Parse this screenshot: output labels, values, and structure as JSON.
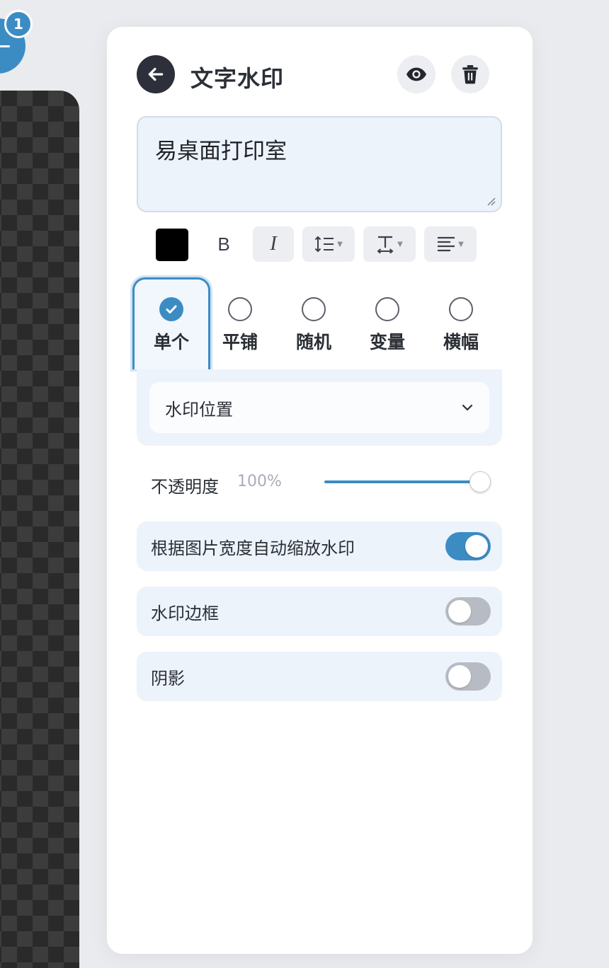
{
  "canvas": {
    "layer_badge": "1"
  },
  "panel": {
    "title": "文字水印",
    "back_icon": "arrow-left-icon",
    "preview_icon": "eye-icon",
    "delete_icon": "trash-icon"
  },
  "text_input": {
    "value": "易桌面打印室"
  },
  "toolbar": {
    "color": "#000000",
    "bold_label": "B",
    "italic_label": "I",
    "line_height_icon": "line-height-icon",
    "letter_spacing_icon": "text-height-icon",
    "align_icon": "align-left-icon"
  },
  "modes": [
    {
      "label": "单个",
      "selected": true
    },
    {
      "label": "平铺",
      "selected": false
    },
    {
      "label": "随机",
      "selected": false
    },
    {
      "label": "变量",
      "selected": false
    },
    {
      "label": "横幅",
      "selected": false
    }
  ],
  "position": {
    "label": "水印位置"
  },
  "opacity": {
    "label": "不透明度",
    "value": "100%",
    "fraction": 1.0
  },
  "toggles": [
    {
      "label": "根据图片宽度自动缩放水印",
      "on": true
    },
    {
      "label": "水印边框",
      "on": false
    },
    {
      "label": "阴影",
      "on": false
    }
  ],
  "colors": {
    "accent": "#3c8cc4",
    "dark": "#2d2f3a",
    "field_bg": "#edf3fb"
  }
}
